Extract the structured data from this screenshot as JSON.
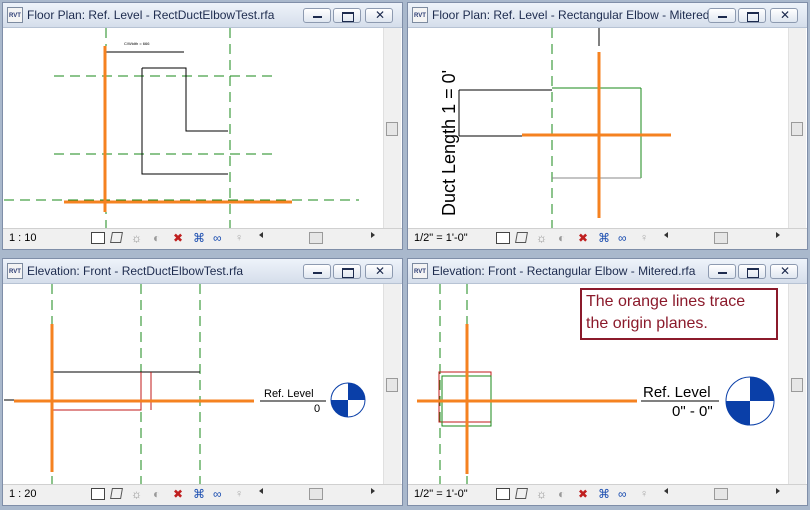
{
  "windows": [
    {
      "title": "Floor Plan: Ref. Level - RectDuctElbowTest.rfa",
      "icon": "RVT",
      "scale": "1 : 10"
    },
    {
      "title": "Floor Plan: Ref. Level - Rectangular Elbow - Mitered.rfa",
      "icon": "RVT",
      "scale": "1/2\" = 1'-0\""
    },
    {
      "title": "Elevation: Front - RectDuctElbowTest.rfa",
      "icon": "RVT",
      "scale": "1 : 20"
    },
    {
      "title": "Elevation: Front - Rectangular Elbow - Mitered.rfa",
      "icon": "RVT",
      "scale": "1/2\" = 1'-0\""
    }
  ],
  "drawings": {
    "duct_length_label": "Duct Length 1 = 0'",
    "ref_level_small": {
      "label": "Ref. Level",
      "value": "0"
    },
    "ref_level_large": {
      "label": "Ref. Level",
      "value": "0\" - 0\""
    },
    "dim_tag": "C/Width = 666"
  },
  "callout": {
    "line1": "The orange lines trace",
    "line2": "the origin planes."
  },
  "colors": {
    "origin_plane": "#f58220",
    "ref_plane": "#1a8a1a",
    "callout_border": "#8b1a2b",
    "level_marker": "#0a3fa8"
  },
  "statusbar_icons": [
    "model-graphics-icon",
    "3d-box-icon",
    "sun-path-icon",
    "shadows-icon",
    "crop-icon",
    "temporary-hide-icon",
    "reveal-hidden-icon",
    "lightbulb-icon"
  ]
}
